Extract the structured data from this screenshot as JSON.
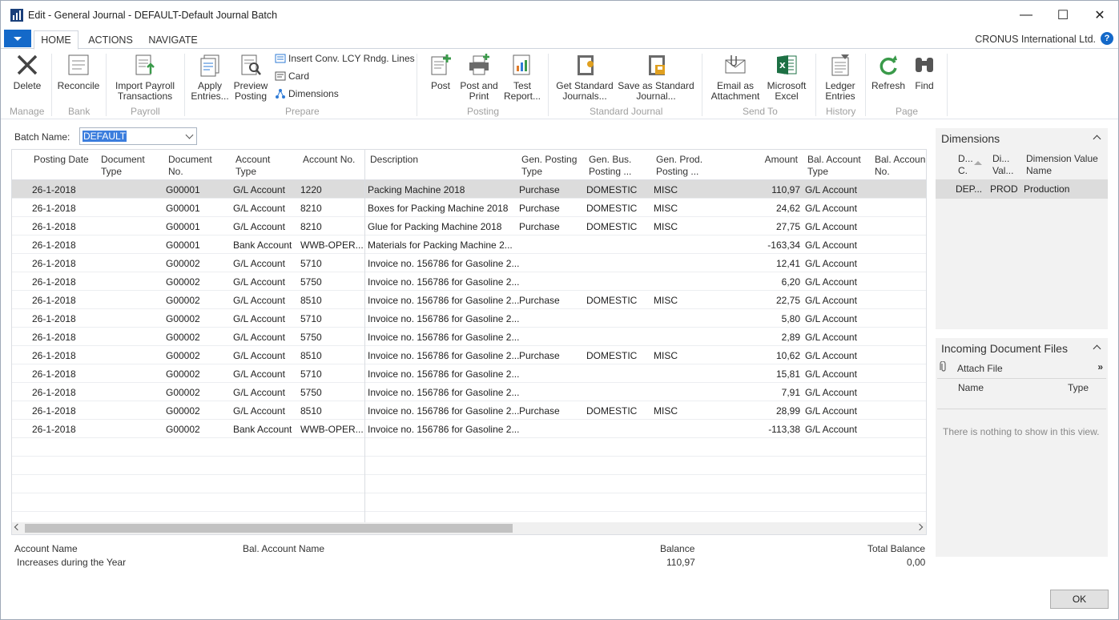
{
  "window": {
    "title": "Edit - General Journal - DEFAULT-Default Journal Batch",
    "minimize": "—",
    "maximize": "☐",
    "close": "✕"
  },
  "tabs": [
    "HOME",
    "ACTIONS",
    "NAVIGATE"
  ],
  "company": "CRONUS International Ltd.",
  "help": "?",
  "ribbon": {
    "delete": "Delete",
    "reconcile": "Reconcile",
    "import_payroll": [
      "Import Payroll",
      "Transactions"
    ],
    "apply_entries": [
      "Apply",
      "Entries..."
    ],
    "preview_posting": [
      "Preview",
      "Posting"
    ],
    "insert_conv": "Insert Conv. LCY Rndg. Lines",
    "card": "Card",
    "dimensions": "Dimensions",
    "post": "Post",
    "post_and_print": [
      "Post and",
      "Print"
    ],
    "test_report": [
      "Test",
      "Report..."
    ],
    "get_standard": [
      "Get Standard",
      "Journals..."
    ],
    "save_standard": [
      "Save as Standard",
      "Journal..."
    ],
    "email_attachment": [
      "Email as",
      "Attachment"
    ],
    "microsoft_excel": [
      "Microsoft",
      "Excel"
    ],
    "ledger_entries": [
      "Ledger",
      "Entries"
    ],
    "refresh": "Refresh",
    "find": "Find",
    "groups": [
      "Manage",
      "Bank",
      "Payroll",
      "Prepare",
      "Posting",
      "Standard Journal",
      "Send To",
      "History",
      "Page"
    ]
  },
  "batch": {
    "label": "Batch Name:",
    "value": "DEFAULT"
  },
  "grid": {
    "headers": {
      "posting_date": "Posting Date",
      "document_type": [
        "Document",
        "Type"
      ],
      "document_no": [
        "Document",
        "No."
      ],
      "account_type": [
        "Account",
        "Type"
      ],
      "account_no": "Account No.",
      "description": "Description",
      "gen_posting_type": [
        "Gen. Posting",
        "Type"
      ],
      "gen_bus": [
        "Gen. Bus.",
        "Posting ..."
      ],
      "gen_prod": [
        "Gen. Prod.",
        "Posting ..."
      ],
      "amount": "Amount",
      "bal_account_type": [
        "Bal. Account",
        "Type"
      ],
      "bal_account_no": [
        "Bal. Accoun",
        "No."
      ]
    },
    "rows": [
      {
        "date": "26-1-2018",
        "docno": "G00001",
        "acctype": "G/L Account",
        "accno": "1220",
        "desc": "Packing Machine 2018",
        "gpt": "Purchase",
        "gbus": "DOMESTIC",
        "gprod": "MISC",
        "amount": "110,97",
        "baltype": "G/L Account"
      },
      {
        "date": "26-1-2018",
        "docno": "G00001",
        "acctype": "G/L Account",
        "accno": "8210",
        "desc": "Boxes for Packing Machine 2018",
        "gpt": "Purchase",
        "gbus": "DOMESTIC",
        "gprod": "MISC",
        "amount": "24,62",
        "baltype": "G/L Account"
      },
      {
        "date": "26-1-2018",
        "docno": "G00001",
        "acctype": "G/L Account",
        "accno": "8210",
        "desc": "Glue for Packing Machine 2018",
        "gpt": "Purchase",
        "gbus": "DOMESTIC",
        "gprod": "MISC",
        "amount": "27,75",
        "baltype": "G/L Account"
      },
      {
        "date": "26-1-2018",
        "docno": "G00001",
        "acctype": "Bank Account",
        "accno": "WWB-OPER...",
        "desc": "Materials for Packing Machine 2...",
        "gpt": "",
        "gbus": "",
        "gprod": "",
        "amount": "-163,34",
        "baltype": "G/L Account"
      },
      {
        "date": "26-1-2018",
        "docno": "G00002",
        "acctype": "G/L Account",
        "accno": "5710",
        "desc": "Invoice no. 156786 for Gasoline 2...",
        "gpt": "",
        "gbus": "",
        "gprod": "",
        "amount": "12,41",
        "baltype": "G/L Account"
      },
      {
        "date": "26-1-2018",
        "docno": "G00002",
        "acctype": "G/L Account",
        "accno": "5750",
        "desc": "Invoice no. 156786 for Gasoline 2...",
        "gpt": "",
        "gbus": "",
        "gprod": "",
        "amount": "6,20",
        "baltype": "G/L Account"
      },
      {
        "date": "26-1-2018",
        "docno": "G00002",
        "acctype": "G/L Account",
        "accno": "8510",
        "desc": "Invoice no. 156786 for Gasoline 2...",
        "gpt": "Purchase",
        "gbus": "DOMESTIC",
        "gprod": "MISC",
        "amount": "22,75",
        "baltype": "G/L Account"
      },
      {
        "date": "26-1-2018",
        "docno": "G00002",
        "acctype": "G/L Account",
        "accno": "5710",
        "desc": "Invoice no. 156786 for Gasoline 2...",
        "gpt": "",
        "gbus": "",
        "gprod": "",
        "amount": "5,80",
        "baltype": "G/L Account"
      },
      {
        "date": "26-1-2018",
        "docno": "G00002",
        "acctype": "G/L Account",
        "accno": "5750",
        "desc": "Invoice no. 156786 for Gasoline 2...",
        "gpt": "",
        "gbus": "",
        "gprod": "",
        "amount": "2,89",
        "baltype": "G/L Account"
      },
      {
        "date": "26-1-2018",
        "docno": "G00002",
        "acctype": "G/L Account",
        "accno": "8510",
        "desc": "Invoice no. 156786 for Gasoline 2...",
        "gpt": "Purchase",
        "gbus": "DOMESTIC",
        "gprod": "MISC",
        "amount": "10,62",
        "baltype": "G/L Account"
      },
      {
        "date": "26-1-2018",
        "docno": "G00002",
        "acctype": "G/L Account",
        "accno": "5710",
        "desc": "Invoice no. 156786 for Gasoline 2...",
        "gpt": "",
        "gbus": "",
        "gprod": "",
        "amount": "15,81",
        "baltype": "G/L Account"
      },
      {
        "date": "26-1-2018",
        "docno": "G00002",
        "acctype": "G/L Account",
        "accno": "5750",
        "desc": "Invoice no. 156786 for Gasoline 2...",
        "gpt": "",
        "gbus": "",
        "gprod": "",
        "amount": "7,91",
        "baltype": "G/L Account"
      },
      {
        "date": "26-1-2018",
        "docno": "G00002",
        "acctype": "G/L Account",
        "accno": "8510",
        "desc": "Invoice no. 156786 for Gasoline 2...",
        "gpt": "Purchase",
        "gbus": "DOMESTIC",
        "gprod": "MISC",
        "amount": "28,99",
        "baltype": "G/L Account"
      },
      {
        "date": "26-1-2018",
        "docno": "G00002",
        "acctype": "Bank Account",
        "accno": "WWB-OPER...",
        "desc": "Invoice no. 156786 for Gasoline 2...",
        "gpt": "",
        "gbus": "",
        "gprod": "",
        "amount": "-113,38",
        "baltype": "G/L Account"
      }
    ]
  },
  "footer": {
    "account_name_label": "Account Name",
    "account_name_value": "Increases during the Year",
    "bal_account_name_label": "Bal. Account Name",
    "balance_label": "Balance",
    "balance_value": "110,97",
    "total_balance_label": "Total Balance",
    "total_balance_value": "0,00"
  },
  "dimensions_box": {
    "title": "Dimensions",
    "headers": [
      [
        "D...",
        "C."
      ],
      [
        "Di...",
        "Val..."
      ],
      [
        "Dimension Value",
        "Name"
      ]
    ],
    "row": [
      "DEP...",
      "PROD",
      "Production"
    ]
  },
  "incoming_box": {
    "title": "Incoming Document Files",
    "attach": "Attach File",
    "more": "»",
    "headers": [
      "Name",
      "Type"
    ],
    "empty": "There is nothing to show in this view."
  },
  "ok_button": "OK",
  "colors": {
    "accent": "#1469c9",
    "selection": "#3b7ddd",
    "row_selected": "#dcdcdc",
    "factbox": "#f2f2f2"
  }
}
